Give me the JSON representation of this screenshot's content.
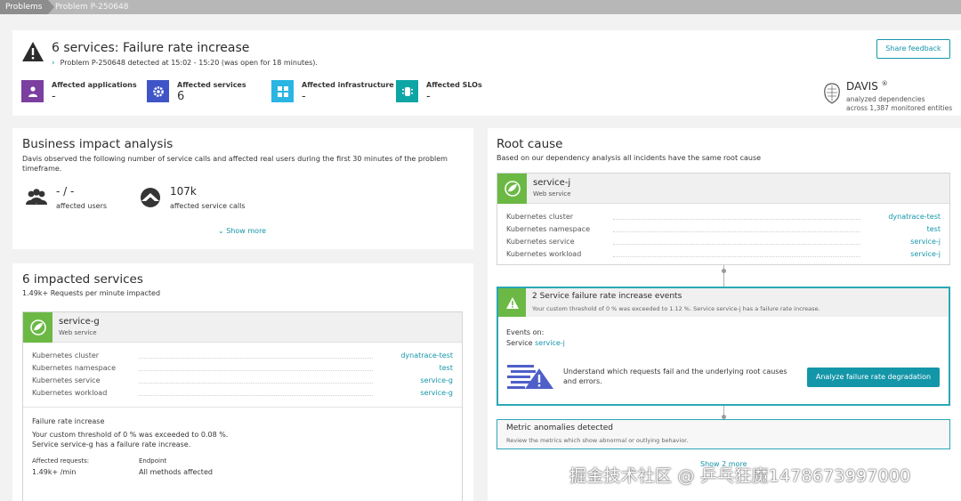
{
  "breadcrumb": {
    "root": "Problems",
    "current": "Problem P-250648"
  },
  "header": {
    "title": "6 services: Failure rate increase",
    "subtitle": "Problem P-250648 detected at 15:02 - 15:20 (was open for 18 minutes).",
    "share_feedback": "Share feedback",
    "affected": [
      {
        "label": "Affected applications",
        "value": "-",
        "icon": "application-icon",
        "color": "#7b3fa0"
      },
      {
        "label": "Affected services",
        "value": "6",
        "icon": "service-icon",
        "color": "#3f55c7"
      },
      {
        "label": "Affected infrastructure",
        "value": "-",
        "icon": "infrastructure-icon",
        "color": "#2ab5e3"
      },
      {
        "label": "Affected SLOs",
        "value": "-",
        "icon": "slo-icon",
        "color": "#0ea5a5"
      }
    ],
    "davis": {
      "name": "DAVIS",
      "mark": "®",
      "line1": "analyzed dependencies",
      "line2": "across 1,387 monitored entities"
    }
  },
  "business_impact": {
    "title": "Business impact analysis",
    "description": "Davis observed the following number of service calls and affected real users during the first 30 minutes of the problem timeframe.",
    "users_value": "- / -",
    "users_label": "affected users",
    "calls_value": "107k",
    "calls_label": "affected service calls",
    "show_more": "Show more"
  },
  "impacted_services": {
    "title": "6 impacted services",
    "subtitle": "1.49k+ Requests per minute impacted",
    "service": {
      "name": "service-g",
      "type": "Web service",
      "props": [
        {
          "key": "Kubernetes cluster",
          "value": "dynatrace-test"
        },
        {
          "key": "Kubernetes namespace",
          "value": "test"
        },
        {
          "key": "Kubernetes service",
          "value": "service-g"
        },
        {
          "key": "Kubernetes workload",
          "value": "service-g"
        }
      ],
      "failure_title": "Failure rate increase",
      "failure_line1": "Your custom threshold of 0 % was exceeded to 0.08 %.",
      "failure_line2": "Service service-g has a failure rate increase.",
      "requests_label": "Affected requests:",
      "requests_value": "1.49k+ /min",
      "endpoint_label": "Endpoint",
      "endpoint_value": "All methods affected"
    }
  },
  "root_cause": {
    "title": "Root cause",
    "subtitle": "Based on our dependency analysis all incidents have the same root cause",
    "service": {
      "name": "service-j",
      "type": "Web service",
      "props": [
        {
          "key": "Kubernetes cluster",
          "value": "dynatrace-test"
        },
        {
          "key": "Kubernetes namespace",
          "value": "test"
        },
        {
          "key": "Kubernetes service",
          "value": "service-j"
        },
        {
          "key": "Kubernetes workload",
          "value": "service-j"
        }
      ]
    },
    "events": {
      "title": "2 Service failure rate increase events",
      "description": "Your custom threshold of 0 % was exceeded to 1.12 %. Service service-j has a failure rate increase.",
      "events_on": "Events on:",
      "service_prefix": "Service",
      "service_link": "service-j",
      "understand": "Understand which requests fail and the underlying root causes and errors.",
      "analyze_button": "Analyze failure rate degradation"
    },
    "metrics": {
      "title": "Metric anomalies detected",
      "description": "Review the metrics which show abnormal or outlying behavior."
    },
    "show_more": "Show 2 more"
  },
  "watermark": "掘金技术社区 @ 乒乓狂魔1478673997000"
}
